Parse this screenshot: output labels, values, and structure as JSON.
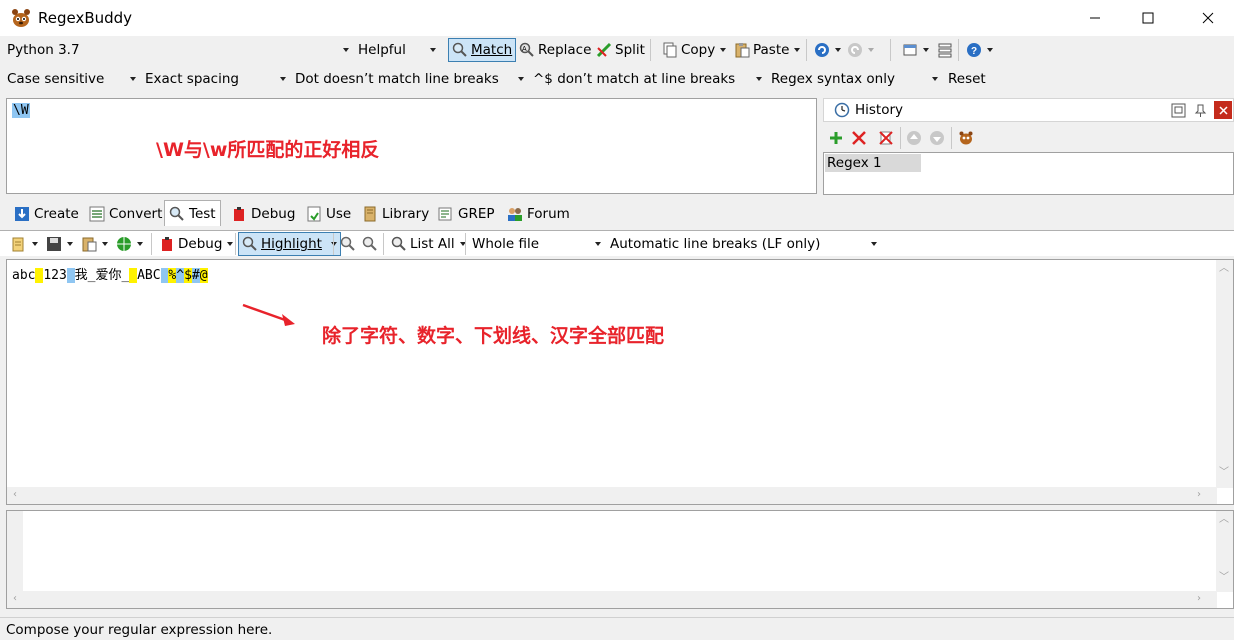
{
  "window": {
    "title": "RegexBuddy"
  },
  "toolbar1": {
    "flavor": "Python 3.7",
    "helpful": "Helpful",
    "match": "Match",
    "replace": "Replace",
    "split": "Split",
    "copy": "Copy",
    "paste": "Paste"
  },
  "toolbar2": {
    "case": "Case sensitive",
    "spacing": "Exact spacing",
    "dot": "Dot doesn’t match line breaks",
    "anchors": "^$ don’t match at line breaks",
    "syntax": "Regex syntax only",
    "reset": "Reset"
  },
  "regex": {
    "text": "\\W",
    "annotation": "\\W与\\w所匹配的正好相反"
  },
  "history": {
    "title": "History",
    "items": [
      "Regex 1"
    ]
  },
  "tabs": [
    "Create",
    "Convert",
    "Test",
    "Debug",
    "Use",
    "Library",
    "GREP",
    "Forum"
  ],
  "test_toolbar": {
    "debug": "Debug",
    "highlight": "Highlight",
    "list_all": "List All",
    "scope": "Whole file",
    "line_breaks": "Automatic line breaks (LF only)"
  },
  "test": {
    "segments": [
      {
        "text": "abc",
        "hl": ""
      },
      {
        "text": " ",
        "hl": "y"
      },
      {
        "text": "123",
        "hl": ""
      },
      {
        "text": " ",
        "hl": "b"
      },
      {
        "text": "我_爱你_",
        "hl": ""
      },
      {
        "text": " ",
        "hl": "y"
      },
      {
        "text": "ABC",
        "hl": ""
      },
      {
        "text": " ",
        "hl": "b"
      },
      {
        "text": "%",
        "hl": "y"
      },
      {
        "text": "^",
        "hl": "b"
      },
      {
        "text": "$",
        "hl": "y"
      },
      {
        "text": "#",
        "hl": "b"
      },
      {
        "text": "@",
        "hl": "y"
      }
    ],
    "annotation": "除了字符、数字、下划线、汉字全部匹配"
  },
  "status": {
    "text": "Compose your regular expression here."
  },
  "colors": {
    "annotation_red": "#e8232b",
    "highlight_yellow": "#fff200",
    "highlight_blue": "#8fc6f2",
    "active_blue": "#cce4f7"
  }
}
